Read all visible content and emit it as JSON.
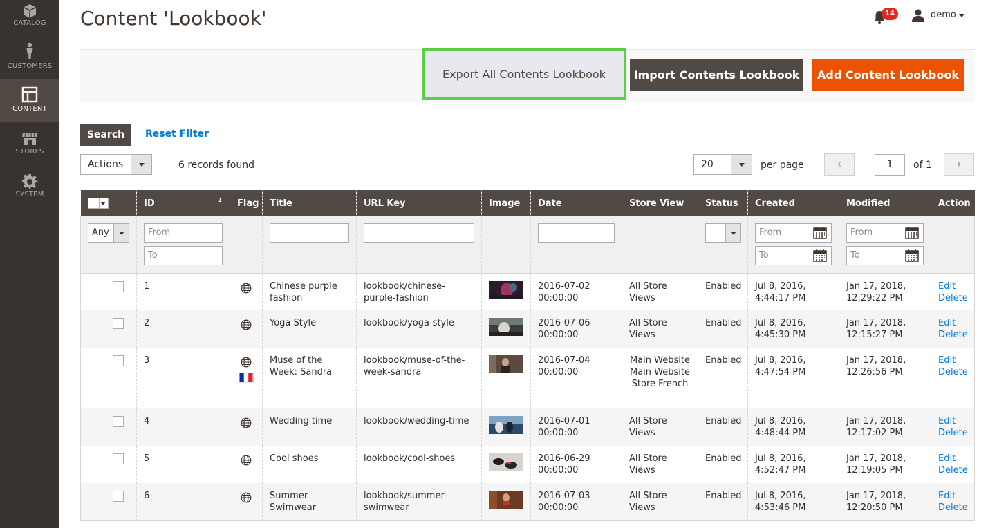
{
  "sidebar": {
    "items": [
      {
        "label": "CATALOG",
        "icon": "box-icon"
      },
      {
        "label": "CUSTOMERS",
        "icon": "person-icon"
      },
      {
        "label": "CONTENT",
        "icon": "layout-icon",
        "active": true
      },
      {
        "label": "STORES",
        "icon": "storefront-icon"
      },
      {
        "label": "SYSTEM",
        "icon": "gear-icon"
      }
    ]
  },
  "header": {
    "title": "Content 'Lookbook'",
    "notifications_count": "14",
    "user_name": "demo"
  },
  "actions_bar": {
    "export_label": "Export All Contents Lookbook",
    "import_label": "Import Contents Lookbook",
    "add_label": "Add Content Lookbook"
  },
  "search": {
    "search_label": "Search",
    "reset_label": "Reset Filter"
  },
  "toolbar": {
    "actions_label": "Actions",
    "records_found": "6 records found",
    "per_page_value": "20",
    "per_page_label": "per page",
    "page_value": "1",
    "page_of": "of 1"
  },
  "grid": {
    "columns": [
      "ID",
      "Flag",
      "Title",
      "URL Key",
      "Image",
      "Date",
      "Store View",
      "Status",
      "Created",
      "Modified",
      "Action"
    ],
    "filters": {
      "mass_any": "Any",
      "from_placeholder": "From",
      "to_placeholder": "To"
    },
    "rows": [
      {
        "id": "1",
        "flag": "globe",
        "title": "Chinese purple fashion",
        "url_key": "lookbook/chinese-purple-fashion",
        "date": "2016-07-02 00:00:00",
        "store_view": "All Store Views",
        "status": "Enabled",
        "created": "Jul 8, 2016, 4:44:17 PM",
        "modified": "Jan 17, 2018, 12:29:22 PM",
        "edit": "Edit",
        "delete": "Delete"
      },
      {
        "id": "2",
        "flag": "globe",
        "title": "Yoga Style",
        "url_key": "lookbook/yoga-style",
        "date": "2016-07-06 00:00:00",
        "store_view": "All Store Views",
        "status": "Enabled",
        "created": "Jul 8, 2016, 4:45:30 PM",
        "modified": "Jan 17, 2018, 12:15:27 PM",
        "edit": "Edit",
        "delete": "Delete"
      },
      {
        "id": "3",
        "flag": "globe+fr",
        "title": "Muse of the Week: Sandra",
        "url_key": "lookbook/muse-of-the-week-sandra",
        "date": "2016-07-04 00:00:00",
        "store_view": "Main Website Main Website Store French",
        "status": "Enabled",
        "created": "Jul 8, 2016, 4:47:54 PM",
        "modified": "Jan 17, 2018, 12:26:56 PM",
        "edit": "Edit",
        "delete": "Delete"
      },
      {
        "id": "4",
        "flag": "globe",
        "title": "Wedding time",
        "url_key": "lookbook/wedding-time",
        "date": "2016-07-01 00:00:00",
        "store_view": "All Store Views",
        "status": "Enabled",
        "created": "Jul 8, 2016, 4:48:44 PM",
        "modified": "Jan 17, 2018, 12:17:02 PM",
        "edit": "Edit",
        "delete": "Delete"
      },
      {
        "id": "5",
        "flag": "globe",
        "title": "Cool shoes",
        "url_key": "lookbook/cool-shoes",
        "date": "2016-06-29 00:00:00",
        "store_view": "All Store Views",
        "status": "Enabled",
        "created": "Jul 8, 2016, 4:52:47 PM",
        "modified": "Jan 17, 2018, 12:19:05 PM",
        "edit": "Edit",
        "delete": "Delete"
      },
      {
        "id": "6",
        "flag": "globe",
        "title": "Summer Swimwear",
        "url_key": "lookbook/summer-swimwear",
        "date": "2016-07-03 00:00:00",
        "store_view": "All Store Views",
        "status": "Enabled",
        "created": "Jul 8, 2016, 4:53:46 PM",
        "modified": "Jan 17, 2018, 12:20:50 PM",
        "edit": "Edit",
        "delete": "Delete"
      }
    ]
  },
  "colors": {
    "sidebar_bg": "#373330",
    "header_row_bg": "#514943",
    "primary_button": "#eb5202",
    "link": "#007bdb",
    "highlight_border": "#5bd046"
  }
}
